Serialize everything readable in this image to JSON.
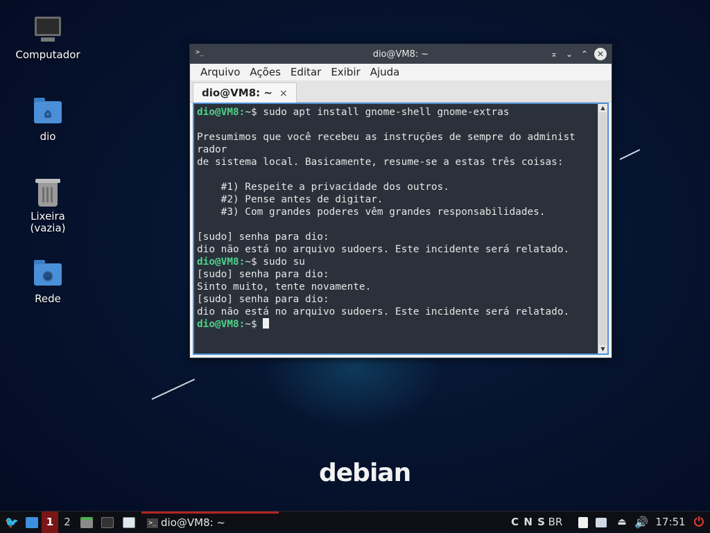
{
  "desktop": {
    "icons": [
      {
        "label": "Computador"
      },
      {
        "label": "dio"
      },
      {
        "label": "Lixeira\n(vazia)"
      },
      {
        "label": "Rede"
      }
    ],
    "wallpaper_text": "debian"
  },
  "window": {
    "title": "dio@VM8: ~",
    "menu": [
      "Arquivo",
      "Ações",
      "Editar",
      "Exibir",
      "Ajuda"
    ],
    "tab_label": "dio@VM8: ~",
    "tab_close": "×",
    "controls": {
      "shade": "⌅",
      "minimize": "⌄",
      "maximize": "⌃",
      "close": "✕"
    }
  },
  "terminal": {
    "prompt": "dio@VM8:",
    "lines": [
      {
        "prompt": "dio@VM8:",
        "text": "~$ sudo apt install gnome-shell gnome-extras"
      },
      {
        "text": ""
      },
      {
        "text": "Presumimos que você recebeu as instruções de sempre do administ"
      },
      {
        "text": "rador"
      },
      {
        "text": "de sistema local. Basicamente, resume-se a estas três coisas:"
      },
      {
        "text": ""
      },
      {
        "text": "    #1) Respeite a privacidade dos outros."
      },
      {
        "text": "    #2) Pense antes de digitar."
      },
      {
        "text": "    #3) Com grandes poderes vêm grandes responsabilidades."
      },
      {
        "text": ""
      },
      {
        "text": "[sudo] senha para dio:"
      },
      {
        "text": "dio não está no arquivo sudoers. Este incidente será relatado."
      },
      {
        "prompt": "dio@VM8:",
        "text": "~$ sudo su"
      },
      {
        "text": "[sudo] senha para dio:"
      },
      {
        "text": "Sinto muito, tente novamente."
      },
      {
        "text": "[sudo] senha para dio:"
      },
      {
        "text": "dio não está no arquivo sudoers. Este incidente será relatado."
      },
      {
        "prompt": "dio@VM8:",
        "text": "~$ ",
        "cursor": true
      }
    ]
  },
  "taskbar": {
    "workspaces": [
      "1",
      "2"
    ],
    "task_label": "dio@VM8: ~",
    "indicators": "C N S",
    "keyboard_layout": "BR",
    "clock": "17:51"
  },
  "colors": {
    "prompt": "#4fd28b",
    "accent": "#4a90d9",
    "active_workspace": "#7a1616"
  }
}
